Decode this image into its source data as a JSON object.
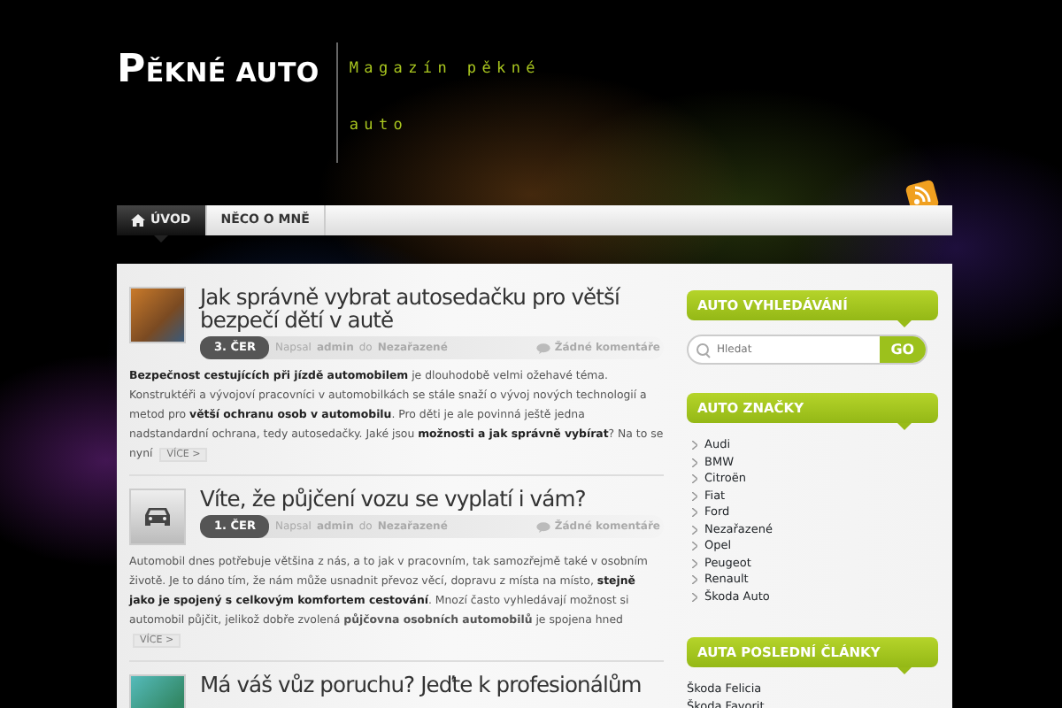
{
  "site": {
    "title": "PĚKNÉ AUTO",
    "tagline": "Magazín pěkné auto"
  },
  "nav": [
    {
      "label": "ÚVOD",
      "selected": true,
      "home": true
    },
    {
      "label": "NĚCO O MNĚ",
      "selected": false,
      "home": false
    }
  ],
  "posts": [
    {
      "kind": "photo",
      "title": "Jak správně vybrat autosedačku pro větší bezpečí dětí v autě",
      "date": "3. ČER",
      "by": "Napsal",
      "author": "admin",
      "in": "do",
      "category": "Nezařazené",
      "comments": "Žádné komentáře",
      "excerpt": [
        {
          "kind": "text",
          "text": "**Bezpečnost cestujících při jízdě automobilem** je dlouhodobě velmi ožehavé téma. Konstruktéři a vývojoví pracovníci v automobilkách se stále snaží o vývoj nových technologií a metod pro **větší ochranu osob v automobilu**. Pro děti je ale povinná ještě jedna nadstandardní ochrana, tedy autosedačky. Jaké jsou **možnosti a jak správně vybírat**? Na to se nyní "
        }
      ],
      "more": "VÍCE >"
    },
    {
      "kind": "car",
      "title": "Víte, že půjčení vozu se vyplatí i vám?",
      "date": "1. ČER",
      "by": "Napsal",
      "author": "admin",
      "in": "do",
      "category": "Nezařazené",
      "comments": "Žádné komentáře",
      "excerpt": [
        {
          "kind": "text",
          "text": "Automobil dnes potřebuje většina z nás, a to jak v pracovním, tak samozřejmě také v osobním životě. Je to dáno tím, že nám může usnadnit převoz věcí, dopravu z místa na místo, **stejně jako je spojený s celkovým komfortem cestování**. Mnozí často vyhledávají možnost si automobil půjčit, jelikož dobře zvolená "
        },
        {
          "kind": "link",
          "text": "půjčovna osobních automobilů"
        },
        {
          "kind": "text",
          "text": " je spojena hned "
        }
      ],
      "more": "VÍCE >"
    },
    {
      "kind": "photo",
      "title": "Má váš vůz poruchu? Jeďte k profesionálům"
    }
  ],
  "sidebar": [
    {
      "kind": "search",
      "title": "AUTO VYHLEDÁVÁNÍ",
      "placeholder": "Hledat",
      "button": "GO"
    },
    {
      "kind": "categories",
      "title": "AUTO ZNAČKY",
      "items": [
        "Audi",
        "BMW",
        "Citroën",
        "Fiat",
        "Ford",
        "Nezařazené",
        "Opel",
        "Peugeot",
        "Renault",
        "Škoda Auto"
      ]
    },
    {
      "kind": "recent",
      "title": "AUTA POSLEDNÍ ČLÁNKY",
      "items": [
        "Škoda Felicia",
        "Škoda Favorit"
      ]
    }
  ]
}
